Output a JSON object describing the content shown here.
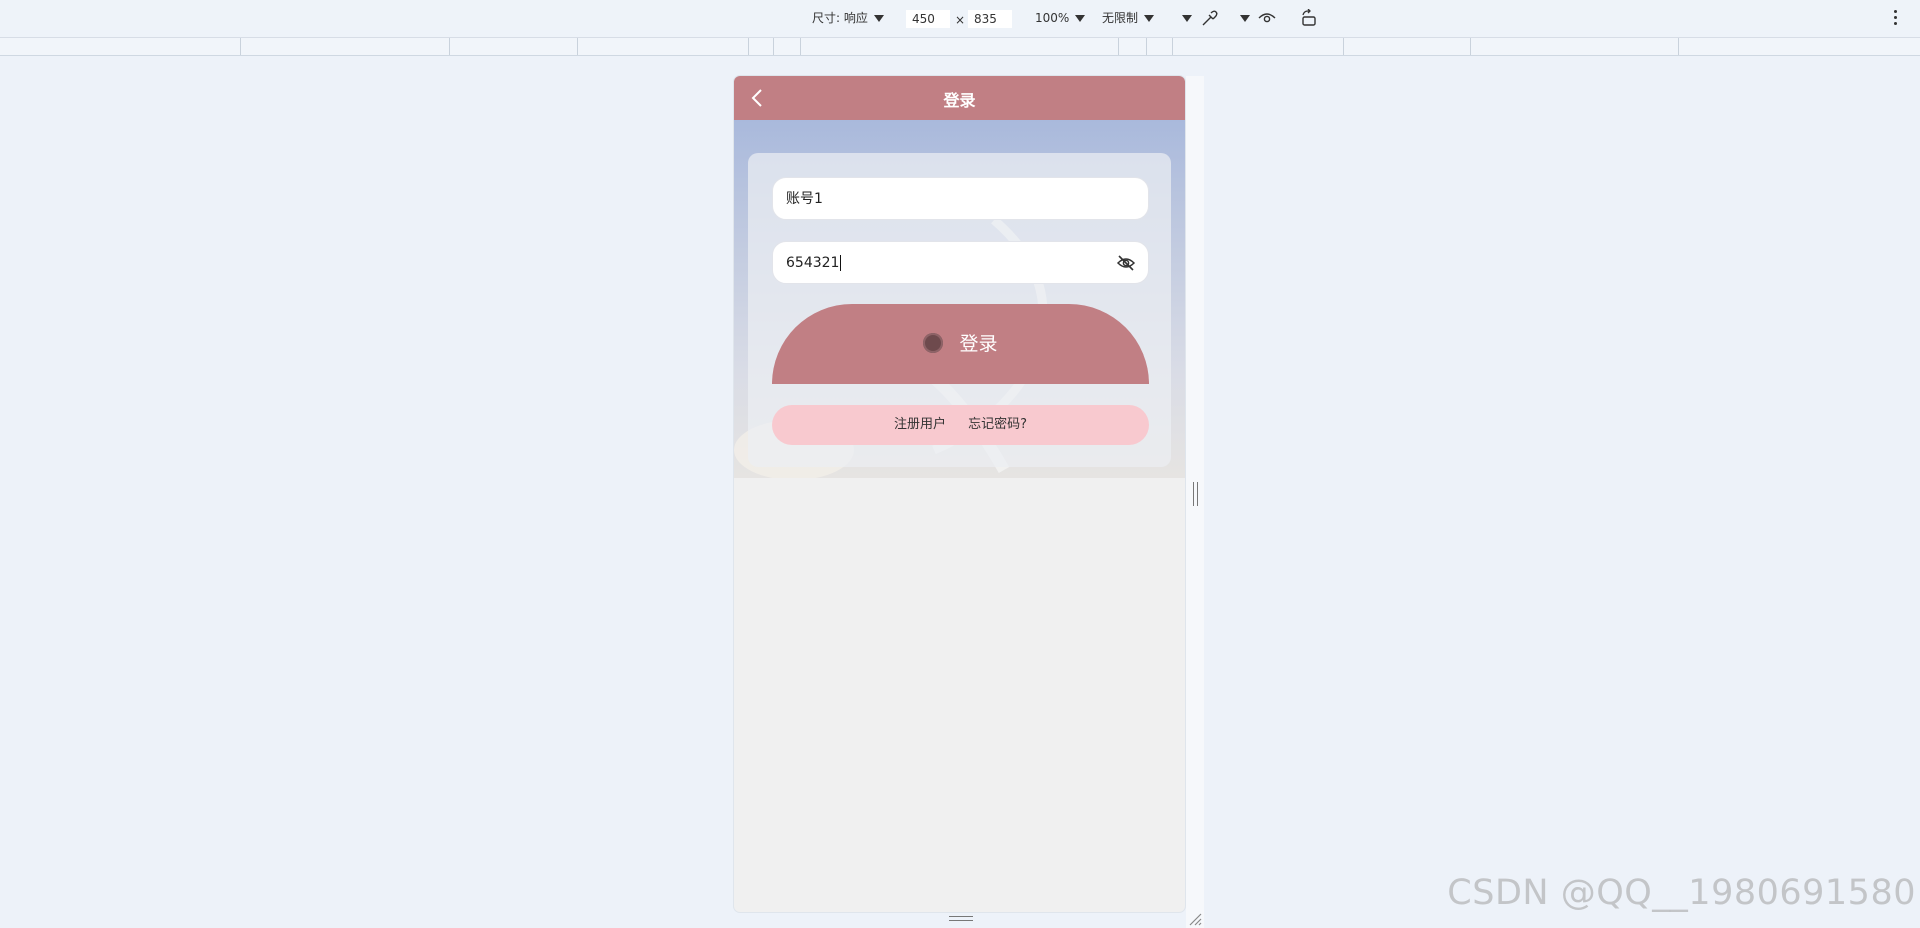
{
  "toolbar": {
    "dimensions_label": "尺寸: 响应",
    "width_value": "450",
    "times_sign": "×",
    "height_value": "835",
    "zoom_label": "100%",
    "throttle_label": "无限制"
  },
  "app": {
    "nav_title": "登录",
    "account_value": "账号1",
    "password_value": "654321",
    "login_button_label": "登录",
    "register_link": "注册用户",
    "forgot_link": "忘记密码?"
  },
  "watermark": "CSDN @QQ__1980691580",
  "colors": {
    "accent": "#c17f84",
    "links_bar": "#f8c9cf",
    "page_bg": "#edf2f9"
  }
}
